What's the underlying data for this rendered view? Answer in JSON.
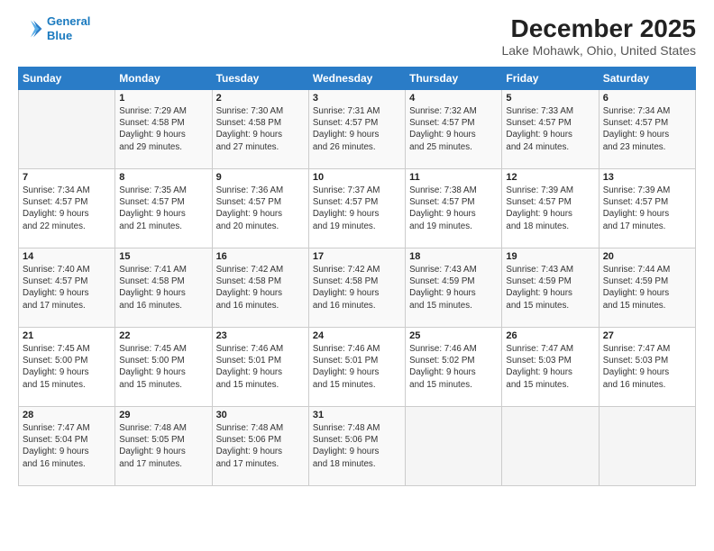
{
  "header": {
    "logo_line1": "General",
    "logo_line2": "Blue",
    "title": "December 2025",
    "subtitle": "Lake Mohawk, Ohio, United States"
  },
  "weekdays": [
    "Sunday",
    "Monday",
    "Tuesday",
    "Wednesday",
    "Thursday",
    "Friday",
    "Saturday"
  ],
  "weeks": [
    [
      {
        "day": "",
        "info": ""
      },
      {
        "day": "1",
        "info": "Sunrise: 7:29 AM\nSunset: 4:58 PM\nDaylight: 9 hours\nand 29 minutes."
      },
      {
        "day": "2",
        "info": "Sunrise: 7:30 AM\nSunset: 4:58 PM\nDaylight: 9 hours\nand 27 minutes."
      },
      {
        "day": "3",
        "info": "Sunrise: 7:31 AM\nSunset: 4:57 PM\nDaylight: 9 hours\nand 26 minutes."
      },
      {
        "day": "4",
        "info": "Sunrise: 7:32 AM\nSunset: 4:57 PM\nDaylight: 9 hours\nand 25 minutes."
      },
      {
        "day": "5",
        "info": "Sunrise: 7:33 AM\nSunset: 4:57 PM\nDaylight: 9 hours\nand 24 minutes."
      },
      {
        "day": "6",
        "info": "Sunrise: 7:34 AM\nSunset: 4:57 PM\nDaylight: 9 hours\nand 23 minutes."
      }
    ],
    [
      {
        "day": "7",
        "info": "Sunrise: 7:34 AM\nSunset: 4:57 PM\nDaylight: 9 hours\nand 22 minutes."
      },
      {
        "day": "8",
        "info": "Sunrise: 7:35 AM\nSunset: 4:57 PM\nDaylight: 9 hours\nand 21 minutes."
      },
      {
        "day": "9",
        "info": "Sunrise: 7:36 AM\nSunset: 4:57 PM\nDaylight: 9 hours\nand 20 minutes."
      },
      {
        "day": "10",
        "info": "Sunrise: 7:37 AM\nSunset: 4:57 PM\nDaylight: 9 hours\nand 19 minutes."
      },
      {
        "day": "11",
        "info": "Sunrise: 7:38 AM\nSunset: 4:57 PM\nDaylight: 9 hours\nand 19 minutes."
      },
      {
        "day": "12",
        "info": "Sunrise: 7:39 AM\nSunset: 4:57 PM\nDaylight: 9 hours\nand 18 minutes."
      },
      {
        "day": "13",
        "info": "Sunrise: 7:39 AM\nSunset: 4:57 PM\nDaylight: 9 hours\nand 17 minutes."
      }
    ],
    [
      {
        "day": "14",
        "info": "Sunrise: 7:40 AM\nSunset: 4:57 PM\nDaylight: 9 hours\nand 17 minutes."
      },
      {
        "day": "15",
        "info": "Sunrise: 7:41 AM\nSunset: 4:58 PM\nDaylight: 9 hours\nand 16 minutes."
      },
      {
        "day": "16",
        "info": "Sunrise: 7:42 AM\nSunset: 4:58 PM\nDaylight: 9 hours\nand 16 minutes."
      },
      {
        "day": "17",
        "info": "Sunrise: 7:42 AM\nSunset: 4:58 PM\nDaylight: 9 hours\nand 16 minutes."
      },
      {
        "day": "18",
        "info": "Sunrise: 7:43 AM\nSunset: 4:59 PM\nDaylight: 9 hours\nand 15 minutes."
      },
      {
        "day": "19",
        "info": "Sunrise: 7:43 AM\nSunset: 4:59 PM\nDaylight: 9 hours\nand 15 minutes."
      },
      {
        "day": "20",
        "info": "Sunrise: 7:44 AM\nSunset: 4:59 PM\nDaylight: 9 hours\nand 15 minutes."
      }
    ],
    [
      {
        "day": "21",
        "info": "Sunrise: 7:45 AM\nSunset: 5:00 PM\nDaylight: 9 hours\nand 15 minutes."
      },
      {
        "day": "22",
        "info": "Sunrise: 7:45 AM\nSunset: 5:00 PM\nDaylight: 9 hours\nand 15 minutes."
      },
      {
        "day": "23",
        "info": "Sunrise: 7:46 AM\nSunset: 5:01 PM\nDaylight: 9 hours\nand 15 minutes."
      },
      {
        "day": "24",
        "info": "Sunrise: 7:46 AM\nSunset: 5:01 PM\nDaylight: 9 hours\nand 15 minutes."
      },
      {
        "day": "25",
        "info": "Sunrise: 7:46 AM\nSunset: 5:02 PM\nDaylight: 9 hours\nand 15 minutes."
      },
      {
        "day": "26",
        "info": "Sunrise: 7:47 AM\nSunset: 5:03 PM\nDaylight: 9 hours\nand 15 minutes."
      },
      {
        "day": "27",
        "info": "Sunrise: 7:47 AM\nSunset: 5:03 PM\nDaylight: 9 hours\nand 16 minutes."
      }
    ],
    [
      {
        "day": "28",
        "info": "Sunrise: 7:47 AM\nSunset: 5:04 PM\nDaylight: 9 hours\nand 16 minutes."
      },
      {
        "day": "29",
        "info": "Sunrise: 7:48 AM\nSunset: 5:05 PM\nDaylight: 9 hours\nand 17 minutes."
      },
      {
        "day": "30",
        "info": "Sunrise: 7:48 AM\nSunset: 5:06 PM\nDaylight: 9 hours\nand 17 minutes."
      },
      {
        "day": "31",
        "info": "Sunrise: 7:48 AM\nSunset: 5:06 PM\nDaylight: 9 hours\nand 18 minutes."
      },
      {
        "day": "",
        "info": ""
      },
      {
        "day": "",
        "info": ""
      },
      {
        "day": "",
        "info": ""
      }
    ]
  ]
}
